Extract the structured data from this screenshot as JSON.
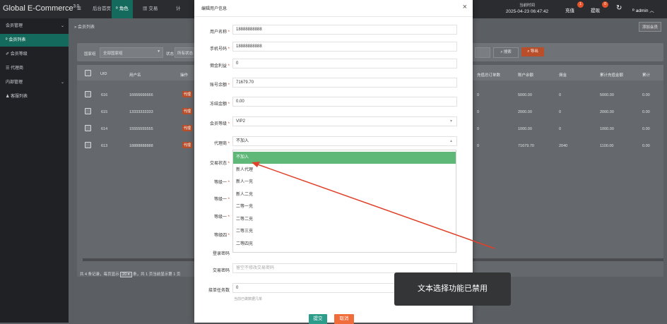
{
  "app": {
    "title": "Global E-Commerce",
    "version": "3.0"
  },
  "topnav": {
    "menu_icon": "≡",
    "items": [
      "后台首页",
      "角色",
      "交易",
      "计"
    ],
    "time_label": "当前时间",
    "time_value": "2025-04-23 06:47:42",
    "recharge": "充值",
    "recharge_badge": "1",
    "withdraw": "提现",
    "withdraw_badge": "0",
    "admin": "admin"
  },
  "sidebar": {
    "items": [
      {
        "label": "会员管理",
        "type": "group"
      },
      {
        "label": "会员列表",
        "type": "active"
      },
      {
        "label": "会员等级",
        "type": "item"
      },
      {
        "label": "代理商",
        "type": "item"
      },
      {
        "label": "内部管理",
        "type": "group"
      },
      {
        "label": "客服列表",
        "type": "item"
      }
    ]
  },
  "main": {
    "breadcrumb": "会员列表",
    "add_button": "添加会员",
    "filter": {
      "label": "国家组",
      "value": "全部国家组",
      "status_label": "状态",
      "status_placeholder": "所有状态"
    },
    "search_button": "搜索",
    "export_button": "导出",
    "table": {
      "headers": [
        "UID",
        "用户名",
        "操作",
        "充值总订单数",
        "账户余额",
        "佣金",
        "累计充值金额",
        "累计"
      ],
      "rows": [
        {
          "uid": "616",
          "username": "16666666666",
          "tag": "代理",
          "orders": "0",
          "balance": "5000.00",
          "commission": "0",
          "recharge": "5000.00",
          "extra": "0.00"
        },
        {
          "uid": "615",
          "username": "13333333333",
          "tag": "代理",
          "orders": "0",
          "balance": "2000.00",
          "commission": "0",
          "recharge": "2000.00",
          "extra": "0.00"
        },
        {
          "uid": "614",
          "username": "15555555555",
          "tag": "代理",
          "orders": "0",
          "balance": "1000.00",
          "commission": "0",
          "recharge": "1000.00",
          "extra": "0.00"
        },
        {
          "uid": "613",
          "username": "18888888888",
          "tag": "代理",
          "orders": "0",
          "balance": "71679.70",
          "commission": "2040",
          "recharge": "1100.00",
          "extra": "0.00"
        }
      ]
    },
    "pager": {
      "text_before": "共 4 条记录，每页显示",
      "per_page": "20",
      "text_after": "条，共 1 页当前显示第 1 页"
    }
  },
  "modal": {
    "title": "编辑用户信息",
    "close": "×",
    "fields": [
      {
        "label": "用户名称",
        "required": true,
        "value": "18888888888"
      },
      {
        "label": "手机号码",
        "required": true,
        "value": "18888888888"
      },
      {
        "label": "佣金利益",
        "required": true,
        "value": "0"
      },
      {
        "label": "账号余额",
        "required": true,
        "value": "71679.70"
      },
      {
        "label": "冻结金额",
        "required": true,
        "value": "0.00"
      },
      {
        "label": "会员等级",
        "required": true,
        "value": "VIP2",
        "select": true
      },
      {
        "label": "代理商",
        "required": true,
        "value": "不加入",
        "select": true,
        "open": true
      },
      {
        "label": "交易状态",
        "required": true,
        "value": ""
      },
      {
        "label": "等级一",
        "required": true,
        "value": ""
      },
      {
        "label": "等级一",
        "required": true,
        "value": ""
      },
      {
        "label": "等级一",
        "required": true,
        "value": ""
      },
      {
        "label": "等级四",
        "required": true,
        "value": ""
      },
      {
        "label": "登录密码",
        "required": false,
        "value": ""
      }
    ],
    "trade_password": {
      "label": "交易密码",
      "placeholder": "留空不修改交易密码"
    },
    "task_count": {
      "label": "接单任务数",
      "value": "0",
      "hint": "当前已做数据几单"
    },
    "dropdown_options": [
      "不加入",
      "新人代理",
      "新人一充",
      "新人二充",
      "二等一充",
      "二等二充",
      "二等三充",
      "二等四充"
    ],
    "submit": "提交",
    "cancel": "取消"
  },
  "toast": "文本选择功能已禁用",
  "colors": {
    "primary": "#146a5c",
    "danger": "#e4532b",
    "selected": "#5fb878",
    "arrow": "#e0412a"
  }
}
